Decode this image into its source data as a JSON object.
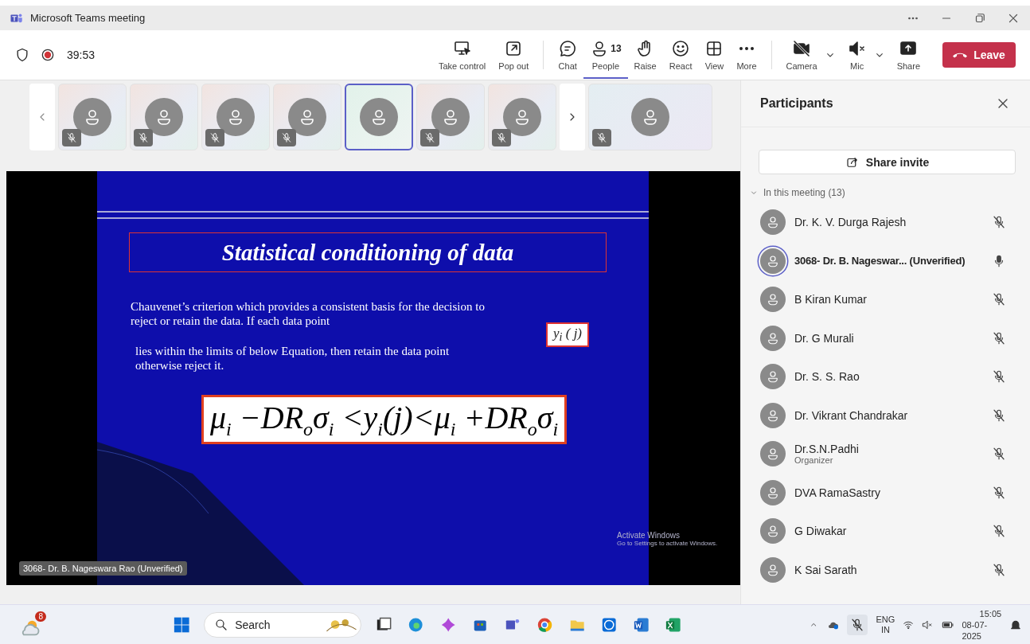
{
  "window": {
    "title": "Microsoft Teams meeting"
  },
  "meeting": {
    "timer": "39:53",
    "recording": true
  },
  "toolbar": {
    "items": [
      {
        "label": "Take control",
        "selected": false,
        "dropdown": false
      },
      {
        "label": "Pop out",
        "selected": false,
        "dropdown": false
      },
      {
        "label": "Chat",
        "selected": false,
        "dropdown": false
      },
      {
        "label": "People",
        "badge": "13",
        "selected": true,
        "dropdown": false
      },
      {
        "label": "Raise",
        "selected": false,
        "dropdown": false
      },
      {
        "label": "React",
        "selected": false,
        "dropdown": false
      },
      {
        "label": "View",
        "selected": false,
        "dropdown": false
      },
      {
        "label": "More",
        "selected": false,
        "dropdown": false
      },
      {
        "label": "Camera",
        "selected": false,
        "dropdown": true
      },
      {
        "label": "Mic",
        "selected": false,
        "dropdown": true
      },
      {
        "label": "Share",
        "selected": false,
        "dropdown": false
      }
    ],
    "leave": "Leave"
  },
  "tiles": [
    {
      "muted": true,
      "selected": false
    },
    {
      "muted": true,
      "selected": false
    },
    {
      "muted": true,
      "selected": false
    },
    {
      "muted": true,
      "selected": false
    },
    {
      "muted": false,
      "selected": true
    },
    {
      "muted": true,
      "selected": false
    },
    {
      "muted": true,
      "selected": false
    }
  ],
  "spotlight_tile": {
    "muted": true
  },
  "presentation": {
    "title": "Statistical conditioning of data",
    "paragraphs": [
      "Chauvenet’s criterion  which provides a consistent basis for the decision to reject or retain the data. If each data point",
      "lies within the limits of  below Equation,  then retain the data point otherwise reject it."
    ],
    "variable_label": "y$_{i}$ ( j)",
    "equation": "μ$_{i}$ −DR$_{o}$σ$_{i}$ <y$_{i}$(j)<μ$_{i}$ +DR$_{o}$σ$_{i}$",
    "activation_notice": [
      "Activate Windows",
      "Go to Settings to activate Windows."
    ],
    "presenter": "3068- Dr. B. Nageswara Rao (Unverified)"
  },
  "participants": {
    "title": "Participants",
    "share_invite": "Share invite",
    "section": {
      "label": "In this meeting (13)",
      "expanded": true
    },
    "people": [
      {
        "name": "Dr. K. V. Durga Rajesh",
        "muted": true,
        "speaking": false
      },
      {
        "name": "3068- Dr. B. Nageswar... (Unverified)",
        "muted": false,
        "speaking": true
      },
      {
        "name": "B Kiran Kumar",
        "muted": true,
        "speaking": false
      },
      {
        "name": "Dr. G Murali",
        "muted": true,
        "speaking": false
      },
      {
        "name": "Dr. S. S. Rao",
        "muted": true,
        "speaking": false
      },
      {
        "name": "Dr. Vikrant Chandrakar",
        "muted": true,
        "speaking": false
      },
      {
        "name": "Dr.S.N.Padhi",
        "role": "Organizer",
        "muted": true,
        "speaking": false
      },
      {
        "name": "DVA RamaSastry",
        "muted": true,
        "speaking": false
      },
      {
        "name": "G Diwakar",
        "muted": true,
        "speaking": false
      },
      {
        "name": "K Sai Sarath",
        "muted": true,
        "speaking": false
      }
    ]
  },
  "taskbar": {
    "weather_badge": "8",
    "search_label": "Search",
    "language": "ENG",
    "region": "IN",
    "time": "15:05",
    "date": "08-07-2025"
  }
}
